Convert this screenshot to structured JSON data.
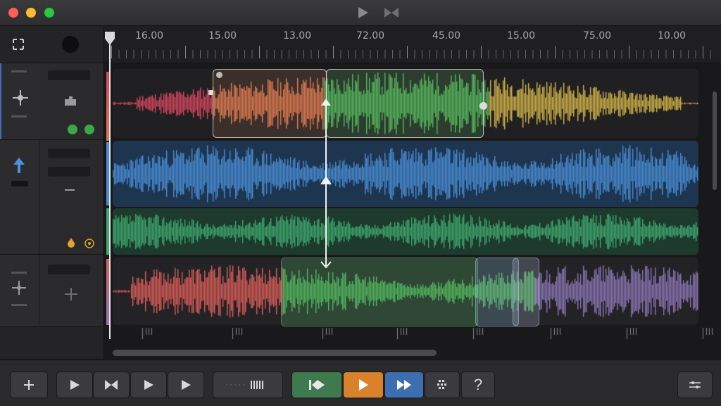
{
  "titlebar": {
    "play_icon": "play-icon",
    "bowtie_icon": "bowtie-icon"
  },
  "ruler": {
    "labels": [
      "16.00",
      "15.00",
      "13.00",
      "72.00",
      "45.00",
      "15.00",
      "75.00",
      "10.00"
    ]
  },
  "tracks": [
    {
      "name": "track-1",
      "colors": [
        "#d9475f",
        "#e07a4a",
        "#52b55a",
        "#d8b84a"
      ]
    },
    {
      "name": "track-2",
      "colors": [
        "#4a8fd6"
      ]
    },
    {
      "name": "track-3",
      "colors": [
        "#3fa970"
      ]
    },
    {
      "name": "track-4",
      "colors": [
        "#e0605a",
        "#52b55a",
        "#8e78b8"
      ]
    }
  ],
  "toolbar": {
    "buttons": [
      "add-icon",
      "play-icon",
      "bowtie-icon",
      "play-icon",
      "play-icon",
      "bars-icon",
      "skip-back-icon",
      "play-icon",
      "fast-forward-icon",
      "grid-icon",
      "help-icon",
      "adjust-icon"
    ],
    "help_label": "?"
  },
  "colors": {
    "accent_green": "#3f7a4f",
    "accent_orange": "#d9822b",
    "accent_blue": "#3c6fb0"
  }
}
